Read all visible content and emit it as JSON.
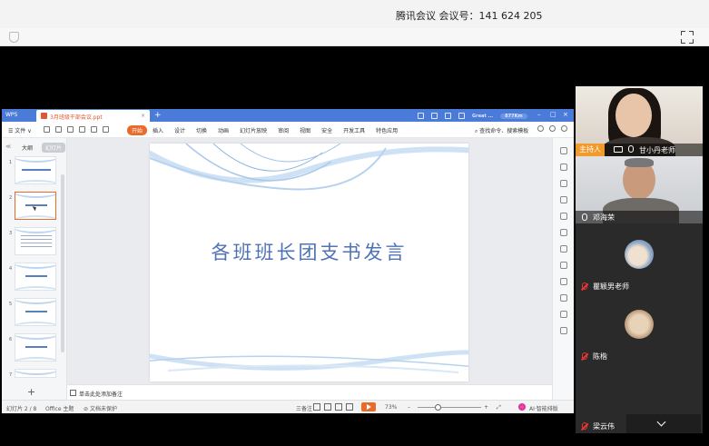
{
  "meeting": {
    "title": "腾讯会议 会议号：141 624 205"
  },
  "wps": {
    "app_name": "WPS",
    "doc_tab": "3月班级干部会议.ppt",
    "tab_close": "×",
    "new_tab": "+",
    "header_search": "Great ...",
    "header_pill": "877Km",
    "window_min": "–",
    "window_max": "□",
    "window_close": "×",
    "file_menu": "☰ 文件 ∨",
    "start_tab": "开始",
    "menus": [
      "插入",
      "设计",
      "切换",
      "动画",
      "幻灯片放映",
      "审阅",
      "视图",
      "安全",
      "开发工具",
      "特色应用"
    ],
    "search_command": "查找命令、搜索模板",
    "panel_tab_outline": "大纲",
    "panel_tab_slides": "幻灯片",
    "panel_collapse": "≪",
    "add_slide": "+",
    "thumbnails": [
      "1",
      "2",
      "3",
      "4",
      "5",
      "6",
      "7"
    ],
    "slide_title": "各班班长团支书发言",
    "notes_placeholder": "单击此处添加备注",
    "status": {
      "slide_count": "幻灯片 2 / 8",
      "theme": "Office 主题",
      "protect": "文档未保护",
      "notes_toggle": "三备注",
      "zoom": "73%",
      "zoom_minus": "–",
      "zoom_plus": "+",
      "ai_layout": "AI·智能排版"
    },
    "colors": {
      "accent": "#4a7bd8",
      "start": "#e96a2b",
      "slide_title": "#4f72b6"
    }
  },
  "participants": [
    {
      "name": "甘小丹老师",
      "role": "主持人",
      "mic": "on",
      "sharing": true
    },
    {
      "name": "邓海荣",
      "mic": "on"
    },
    {
      "name": "瞿颖男老师",
      "mic": "muted"
    },
    {
      "name": "陈楷",
      "mic": "muted"
    },
    {
      "name": "梁云伟",
      "mic": "muted"
    }
  ]
}
